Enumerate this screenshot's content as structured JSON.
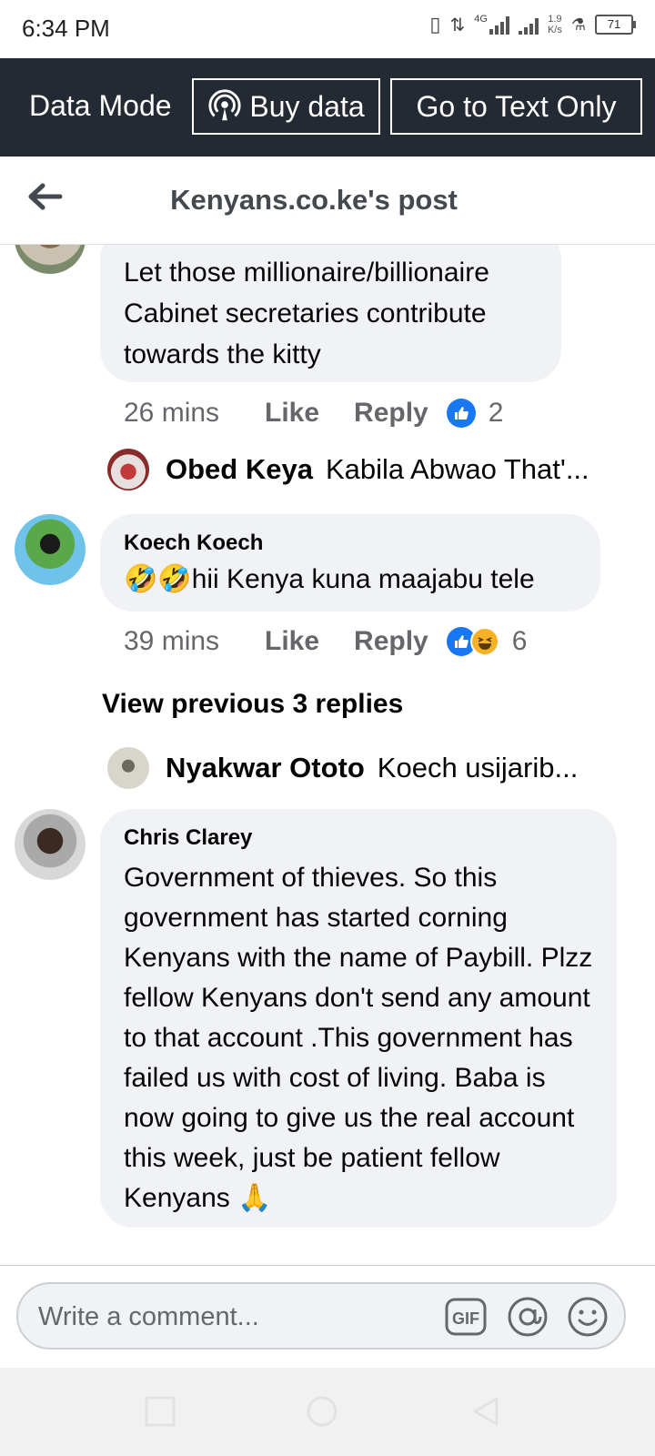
{
  "status_bar": {
    "time": "6:34 PM",
    "network": "4G",
    "speed_value": "1.9",
    "speed_unit": "K/s",
    "battery": "71"
  },
  "data_bar": {
    "mode_label": "Data Mode",
    "buy_label": "Buy data",
    "text_only_label": "Go to Text Only"
  },
  "header": {
    "title": "Kenyans.co.ke's post"
  },
  "comments": [
    {
      "author": "",
      "text": "Let those millionaire/billionaire Cabinet secretaries contribute towards the kitty",
      "time": "26 mins",
      "like": "Like",
      "reply": "Reply",
      "reactions": [
        "like-icon"
      ],
      "reaction_count": "2",
      "reply_preview": {
        "name": "Obed Keya",
        "text": "Kabila Abwao That'..."
      }
    },
    {
      "author": "Koech Koech",
      "text": "🤣🤣hii Kenya kuna maajabu tele",
      "time": "39 mins",
      "like": "Like",
      "reply": "Reply",
      "reactions": [
        "like-icon",
        "haha-icon"
      ],
      "reaction_count": "6",
      "view_previous": "View previous 3 replies",
      "reply_preview": {
        "name": "Nyakwar Ototo",
        "text": "Koech usijarib..."
      }
    },
    {
      "author": "Chris Clarey",
      "text": "Government of thieves. So this government has started corning Kenyans with the name of Paybill. Plzz fellow Kenyans don't send any amount to that account .This government has failed us with cost of living. Baba is now going to give us the real account this week, just be patient fellow Kenyans 🙏"
    }
  ],
  "composer": {
    "placeholder": "Write a comment..."
  },
  "colors": {
    "data_bar_bg": "#242a33",
    "bubble_bg": "#f0f2f5",
    "like_blue": "#1877f2",
    "meta_gray": "#65676b"
  }
}
